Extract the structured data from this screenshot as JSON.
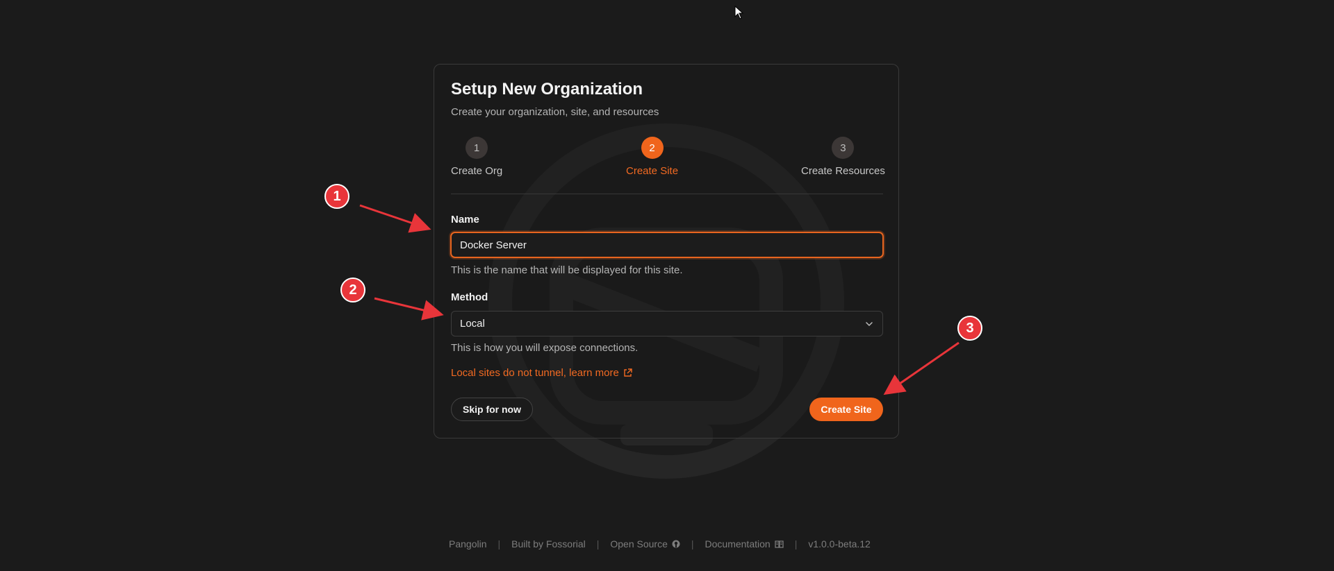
{
  "card": {
    "title": "Setup New Organization",
    "subtitle": "Create your organization, site, and resources"
  },
  "steps": [
    {
      "number": "1",
      "label": "Create Org",
      "active": false
    },
    {
      "number": "2",
      "label": "Create Site",
      "active": true
    },
    {
      "number": "3",
      "label": "Create Resources",
      "active": false
    }
  ],
  "form": {
    "name_label": "Name",
    "name_value": "Docker Server",
    "name_helper": "This is the name that will be displayed for this site.",
    "method_label": "Method",
    "method_value": "Local",
    "method_helper": "This is how you will expose connections.",
    "local_note": "Local sites do not tunnel, learn more"
  },
  "buttons": {
    "skip": "Skip for now",
    "create": "Create Site"
  },
  "footer": {
    "brand": "Pangolin",
    "built_by": "Built by Fossorial",
    "open_source": "Open Source",
    "documentation": "Documentation",
    "version": "v1.0.0-beta.12"
  },
  "annotations": [
    "1",
    "2",
    "3"
  ],
  "colors": {
    "accent": "#f0651c",
    "background": "#1b1b1b",
    "annotation": "#e8353a"
  },
  "icons": {
    "method_select": "chevron-down-icon",
    "learn_more": "external-link-icon",
    "open_source": "github-icon",
    "documentation": "book-icon"
  }
}
